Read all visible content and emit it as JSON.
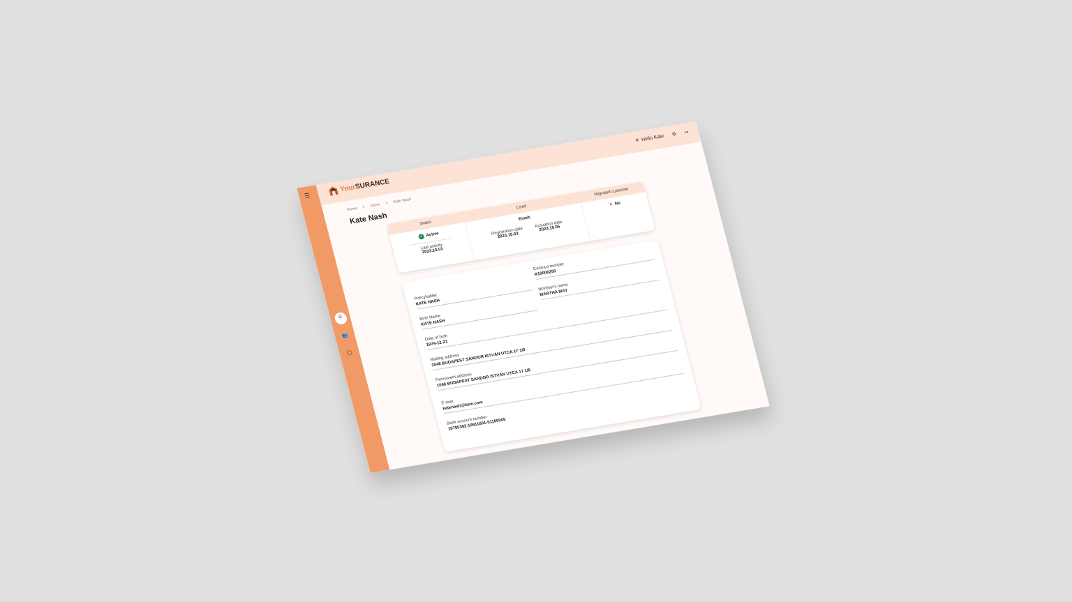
{
  "app": {
    "brand_your": "Your",
    "brand_surance": "SURANCE",
    "greeting": "Hello Kate"
  },
  "breadcrumb": {
    "home": "Home",
    "users": "Users",
    "current": "Kate Nash",
    "separator": ">"
  },
  "page": {
    "title": "Kate Nash"
  },
  "summary": {
    "status_label": "Status",
    "status_value": "Active",
    "last_activity_label": "Last activity",
    "last_activity_value": "2023.10.03",
    "level_label": "Level",
    "level_value": "Emelt",
    "registration_label": "Registration date",
    "registration_value": "2023.10.03",
    "activation_label": "Activation date",
    "activation_value": "2023.10.05",
    "migrated_label": "Migrated customer",
    "migrated_value": "No"
  },
  "details": {
    "policyholder_label": "Policyholder",
    "policyholder_value": "KATE NASH",
    "contract_label": "Contract number",
    "contract_value": "R10006250",
    "birth_name_label": "Birth Name",
    "birth_name_value": "KATE NASH",
    "mother_label": "Monther's name",
    "mother_value": "MARTHA MAY",
    "dob_label": "Date of birth",
    "dob_value": "1979-12-21",
    "mailing_label": "Mailing address",
    "mailing_value": "1048 BUDAPEST SÁNDOR ISTVÁN UTCA 17 1/8",
    "permanent_label": "Permanent address",
    "permanent_value": "1048 BUDAPEST SÁNDOR ISTVÁN UTCA 17 1/8",
    "email_label": "E-mail",
    "email_value": "katenash@kate.com",
    "bank_label": "Bank account number",
    "bank_value": "10700392-19911001-51100005"
  },
  "icons": {
    "menu": "menu-icon",
    "document": "document-icon",
    "users": "users-icon",
    "chat": "chat-icon",
    "sun": "sun-icon",
    "settings": "gear-icon",
    "logout": "logout-icon"
  },
  "colors": {
    "sidebar": "#f29a66",
    "topbar": "#fde3d5",
    "brand_accent": "#e27d3f",
    "active_green": "#1e8c5a",
    "no_red": "#c0392b"
  }
}
